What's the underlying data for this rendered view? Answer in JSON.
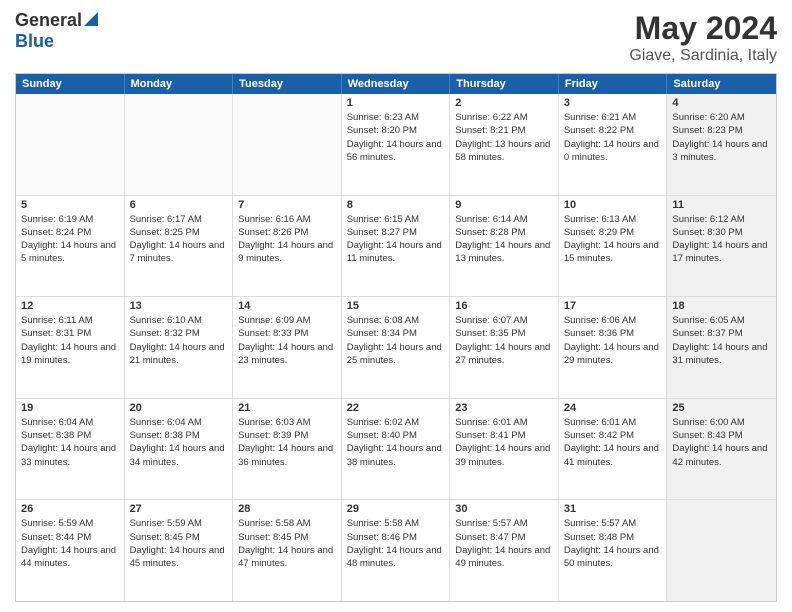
{
  "logo": {
    "general": "General",
    "blue": "Blue"
  },
  "title": "May 2024",
  "location": "Giave, Sardinia, Italy",
  "days": [
    "Sunday",
    "Monday",
    "Tuesday",
    "Wednesday",
    "Thursday",
    "Friday",
    "Saturday"
  ],
  "rows": [
    [
      {
        "day": "",
        "empty": true
      },
      {
        "day": "",
        "empty": true
      },
      {
        "day": "",
        "empty": true
      },
      {
        "day": "1",
        "sunrise": "Sunrise: 6:23 AM",
        "sunset": "Sunset: 8:20 PM",
        "daylight": "Daylight: 14 hours and 56 minutes."
      },
      {
        "day": "2",
        "sunrise": "Sunrise: 6:22 AM",
        "sunset": "Sunset: 8:21 PM",
        "daylight": "Daylight: 13 hours and 58 minutes."
      },
      {
        "day": "3",
        "sunrise": "Sunrise: 6:21 AM",
        "sunset": "Sunset: 8:22 PM",
        "daylight": "Daylight: 14 hours and 0 minutes."
      },
      {
        "day": "4",
        "sunrise": "Sunrise: 6:20 AM",
        "sunset": "Sunset: 8:23 PM",
        "daylight": "Daylight: 14 hours and 3 minutes.",
        "shaded": true
      }
    ],
    [
      {
        "day": "5",
        "sunrise": "Sunrise: 6:19 AM",
        "sunset": "Sunset: 8:24 PM",
        "daylight": "Daylight: 14 hours and 5 minutes."
      },
      {
        "day": "6",
        "sunrise": "Sunrise: 6:17 AM",
        "sunset": "Sunset: 8:25 PM",
        "daylight": "Daylight: 14 hours and 7 minutes."
      },
      {
        "day": "7",
        "sunrise": "Sunrise: 6:16 AM",
        "sunset": "Sunset: 8:26 PM",
        "daylight": "Daylight: 14 hours and 9 minutes."
      },
      {
        "day": "8",
        "sunrise": "Sunrise: 6:15 AM",
        "sunset": "Sunset: 8:27 PM",
        "daylight": "Daylight: 14 hours and 11 minutes."
      },
      {
        "day": "9",
        "sunrise": "Sunrise: 6:14 AM",
        "sunset": "Sunset: 8:28 PM",
        "daylight": "Daylight: 14 hours and 13 minutes."
      },
      {
        "day": "10",
        "sunrise": "Sunrise: 6:13 AM",
        "sunset": "Sunset: 8:29 PM",
        "daylight": "Daylight: 14 hours and 15 minutes."
      },
      {
        "day": "11",
        "sunrise": "Sunrise: 6:12 AM",
        "sunset": "Sunset: 8:30 PM",
        "daylight": "Daylight: 14 hours and 17 minutes.",
        "shaded": true
      }
    ],
    [
      {
        "day": "12",
        "sunrise": "Sunrise: 6:11 AM",
        "sunset": "Sunset: 8:31 PM",
        "daylight": "Daylight: 14 hours and 19 minutes."
      },
      {
        "day": "13",
        "sunrise": "Sunrise: 6:10 AM",
        "sunset": "Sunset: 8:32 PM",
        "daylight": "Daylight: 14 hours and 21 minutes."
      },
      {
        "day": "14",
        "sunrise": "Sunrise: 6:09 AM",
        "sunset": "Sunset: 8:33 PM",
        "daylight": "Daylight: 14 hours and 23 minutes."
      },
      {
        "day": "15",
        "sunrise": "Sunrise: 6:08 AM",
        "sunset": "Sunset: 8:34 PM",
        "daylight": "Daylight: 14 hours and 25 minutes."
      },
      {
        "day": "16",
        "sunrise": "Sunrise: 6:07 AM",
        "sunset": "Sunset: 8:35 PM",
        "daylight": "Daylight: 14 hours and 27 minutes."
      },
      {
        "day": "17",
        "sunrise": "Sunrise: 6:06 AM",
        "sunset": "Sunset: 8:36 PM",
        "daylight": "Daylight: 14 hours and 29 minutes."
      },
      {
        "day": "18",
        "sunrise": "Sunrise: 6:05 AM",
        "sunset": "Sunset: 8:37 PM",
        "daylight": "Daylight: 14 hours and 31 minutes.",
        "shaded": true
      }
    ],
    [
      {
        "day": "19",
        "sunrise": "Sunrise: 6:04 AM",
        "sunset": "Sunset: 8:38 PM",
        "daylight": "Daylight: 14 hours and 33 minutes."
      },
      {
        "day": "20",
        "sunrise": "Sunrise: 6:04 AM",
        "sunset": "Sunset: 8:38 PM",
        "daylight": "Daylight: 14 hours and 34 minutes."
      },
      {
        "day": "21",
        "sunrise": "Sunrise: 6:03 AM",
        "sunset": "Sunset: 8:39 PM",
        "daylight": "Daylight: 14 hours and 36 minutes."
      },
      {
        "day": "22",
        "sunrise": "Sunrise: 6:02 AM",
        "sunset": "Sunset: 8:40 PM",
        "daylight": "Daylight: 14 hours and 38 minutes."
      },
      {
        "day": "23",
        "sunrise": "Sunrise: 6:01 AM",
        "sunset": "Sunset: 8:41 PM",
        "daylight": "Daylight: 14 hours and 39 minutes."
      },
      {
        "day": "24",
        "sunrise": "Sunrise: 6:01 AM",
        "sunset": "Sunset: 8:42 PM",
        "daylight": "Daylight: 14 hours and 41 minutes."
      },
      {
        "day": "25",
        "sunrise": "Sunrise: 6:00 AM",
        "sunset": "Sunset: 8:43 PM",
        "daylight": "Daylight: 14 hours and 42 minutes.",
        "shaded": true
      }
    ],
    [
      {
        "day": "26",
        "sunrise": "Sunrise: 5:59 AM",
        "sunset": "Sunset: 8:44 PM",
        "daylight": "Daylight: 14 hours and 44 minutes."
      },
      {
        "day": "27",
        "sunrise": "Sunrise: 5:59 AM",
        "sunset": "Sunset: 8:45 PM",
        "daylight": "Daylight: 14 hours and 45 minutes."
      },
      {
        "day": "28",
        "sunrise": "Sunrise: 5:58 AM",
        "sunset": "Sunset: 8:45 PM",
        "daylight": "Daylight: 14 hours and 47 minutes."
      },
      {
        "day": "29",
        "sunrise": "Sunrise: 5:58 AM",
        "sunset": "Sunset: 8:46 PM",
        "daylight": "Daylight: 14 hours and 48 minutes."
      },
      {
        "day": "30",
        "sunrise": "Sunrise: 5:57 AM",
        "sunset": "Sunset: 8:47 PM",
        "daylight": "Daylight: 14 hours and 49 minutes."
      },
      {
        "day": "31",
        "sunrise": "Sunrise: 5:57 AM",
        "sunset": "Sunset: 8:48 PM",
        "daylight": "Daylight: 14 hours and 50 minutes."
      },
      {
        "day": "",
        "empty": true,
        "shaded": true
      }
    ]
  ]
}
